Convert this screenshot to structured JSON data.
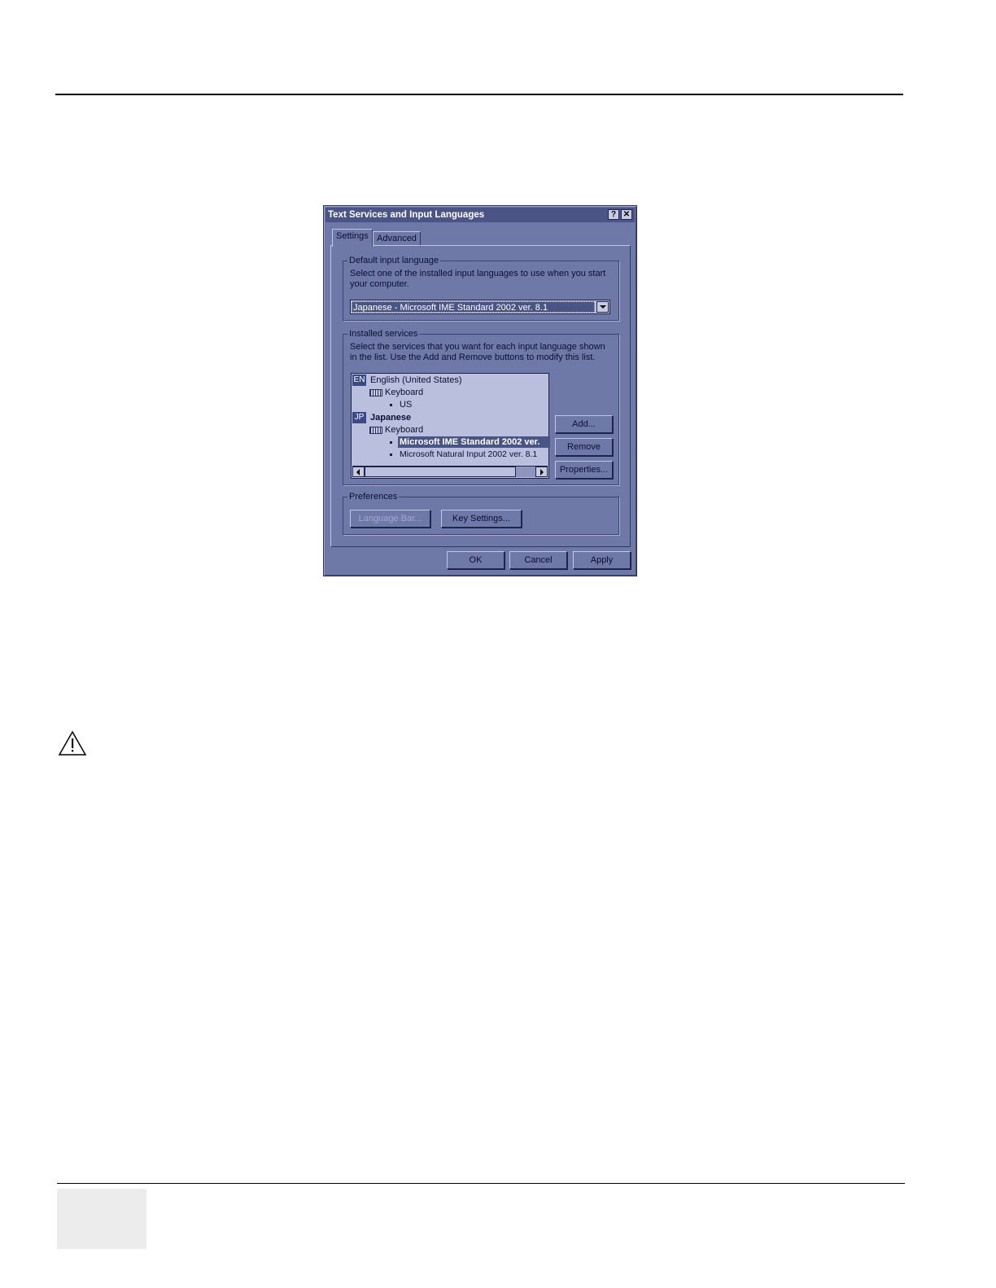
{
  "dialog": {
    "title": "Text Services and Input Languages",
    "help_glyph": "?",
    "close_glyph": "✕",
    "tabs": [
      {
        "label": "Settings",
        "active": true
      },
      {
        "label": "Advanced",
        "active": false
      }
    ],
    "default_input": {
      "label": "Default input language",
      "description": "Select one of the installed input languages to use when you start your computer.",
      "selected": "Japanese - Microsoft IME Standard 2002 ver. 8.1"
    },
    "installed": {
      "label": "Installed services",
      "description": "Select the services that you want for each input language shown in the list. Use the Add and Remove buttons to modify this list.",
      "tree": {
        "lang1_code": "EN",
        "lang1_name": "English (United States)",
        "lang1_kb": "Keyboard",
        "lang1_layout": "US",
        "lang2_code": "JP",
        "lang2_name": "Japanese",
        "lang2_kb": "Keyboard",
        "lang2_item1": "Microsoft IME Standard 2002 ver.",
        "lang2_item2": "Microsoft Natural Input 2002 ver. 8.1"
      },
      "buttons": {
        "add": "Add...",
        "remove": "Remove",
        "properties": "Properties..."
      }
    },
    "preferences": {
      "label": "Preferences",
      "language_bar": "Language Bar...",
      "key_settings": "Key Settings..."
    },
    "footer": {
      "ok": "OK",
      "cancel": "Cancel",
      "apply": "Apply"
    }
  },
  "icons": {
    "warning": "warning-triangle-icon",
    "keyboard": "keyboard-icon"
  }
}
